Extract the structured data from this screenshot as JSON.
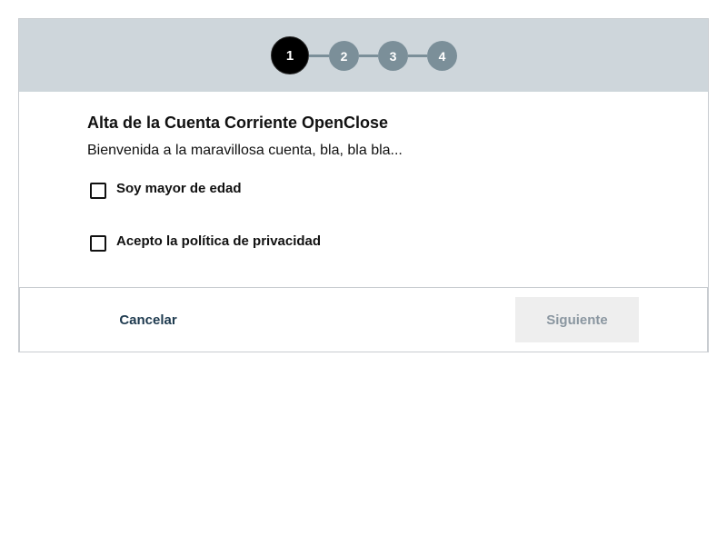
{
  "stepper": {
    "steps": [
      {
        "label": "1",
        "state": "active"
      },
      {
        "label": "2",
        "state": "inactive"
      },
      {
        "label": "3",
        "state": "inactive"
      },
      {
        "label": "4",
        "state": "inactive"
      }
    ],
    "current_step": 1
  },
  "content": {
    "title": "Alta de la Cuenta Corriente OpenClose",
    "subtitle": "Bienvenida a la maravillosa cuenta, bla, bla bla..."
  },
  "checkboxes": [
    {
      "label": "Soy mayor de edad",
      "checked": false
    },
    {
      "label": "Acepto la política de privacidad",
      "checked": false
    }
  ],
  "footer": {
    "cancel_label": "Cancelar",
    "next_label": "Siguiente",
    "next_enabled": false
  },
  "colors": {
    "stepper_background": "#ced6db",
    "step_active": "#000000",
    "step_inactive": "#7b8f99",
    "cancel_text": "#1e3a4f",
    "next_disabled_bg": "#eeeeee",
    "next_disabled_text": "#8a96a0"
  }
}
